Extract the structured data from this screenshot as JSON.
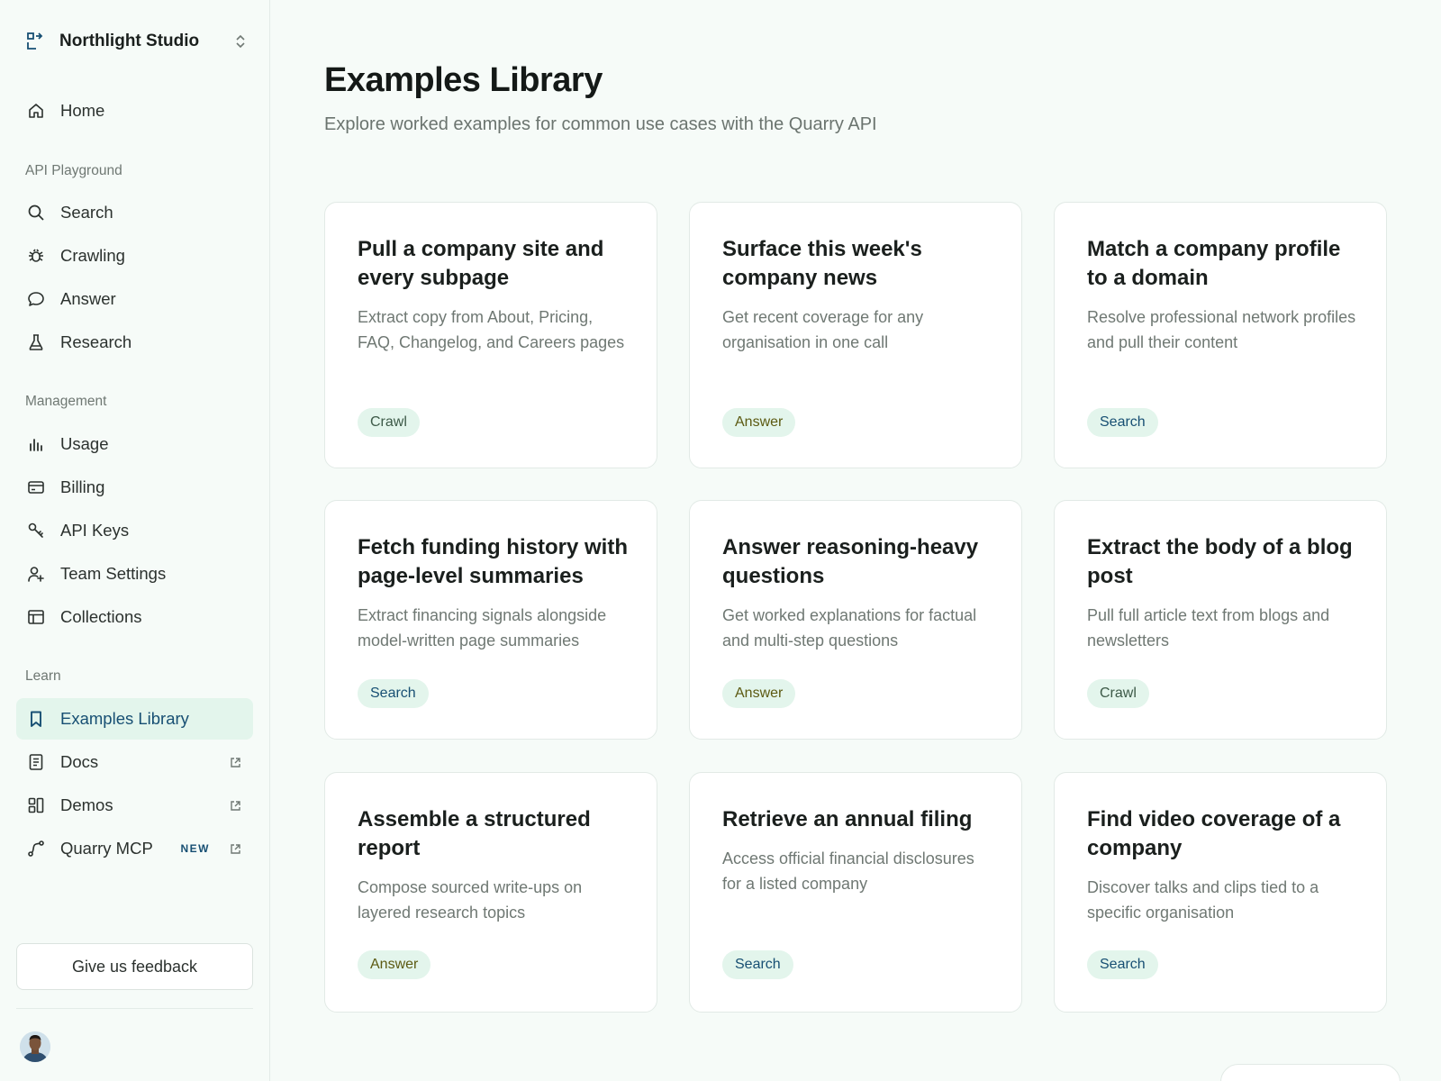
{
  "brand": {
    "name": "Northlight Studio"
  },
  "nav": {
    "home": "Home",
    "sections": {
      "playground": "API Playground",
      "management": "Management",
      "learn": "Learn"
    },
    "playground_items": [
      "Search",
      "Crawling",
      "Answer",
      "Research"
    ],
    "management_items": [
      "Usage",
      "Billing",
      "API Keys",
      "Team Settings",
      "Collections"
    ],
    "learn_items": [
      "Examples Library",
      "Docs",
      "Demos",
      "Quarry MCP"
    ],
    "new_badge": "NEW",
    "active": "Examples Library"
  },
  "feedback": {
    "label": "Give us feedback"
  },
  "header": {
    "title": "Examples Library",
    "subtitle": "Explore worked examples for common use cases with the Quarry API"
  },
  "cards": [
    {
      "title": "Pull a company site and every subpage",
      "desc": "Extract copy from About, Pricing, FAQ, Changelog, and Careers pages",
      "tag": "Crawl"
    },
    {
      "title": "Surface this week's company news",
      "desc": "Get recent coverage for any organisation in one call",
      "tag": "Answer"
    },
    {
      "title": "Match a company profile to a domain",
      "desc": "Resolve professional network profiles and pull their content",
      "tag": "Search"
    },
    {
      "title": "Fetch funding history with page-level summaries",
      "desc": "Extract financing signals alongside model-written page summaries",
      "tag": "Search"
    },
    {
      "title": "Answer reasoning-heavy questions",
      "desc": "Get worked explanations for factual and multi-step questions",
      "tag": "Answer"
    },
    {
      "title": "Extract the body of a blog post",
      "desc": "Pull full article text from blogs and newsletters",
      "tag": "Crawl"
    },
    {
      "title": "Assemble a structured report",
      "desc": "Compose sourced write-ups on layered research topics",
      "tag": "Answer"
    },
    {
      "title": "Retrieve an annual filing",
      "desc": "Access official financial disclosures for a listed company",
      "tag": "Search"
    },
    {
      "title": "Find video coverage of a company",
      "desc": "Discover talks and clips tied to a specific organisation",
      "tag": "Search"
    }
  ],
  "colors": {
    "accent": "#174f73",
    "active_bg": "#e3f5ec",
    "page_bg": "#f6fbf8",
    "tag_bg": "#e3f5ec"
  },
  "icons": {
    "brand": "logo-icon",
    "home": "home-icon",
    "search": "search-icon",
    "crawling": "bug-icon",
    "answer": "chat-bubble-icon",
    "research": "flask-icon",
    "usage": "bar-chart-icon",
    "billing": "credit-card-icon",
    "api_keys": "key-icon",
    "team": "user-plus-icon",
    "collections": "table-icon",
    "examples": "bookmark-icon",
    "docs": "document-icon",
    "demos": "layout-icon",
    "mcp": "route-icon",
    "external": "external-link-icon",
    "switcher": "chevron-updown-icon"
  }
}
